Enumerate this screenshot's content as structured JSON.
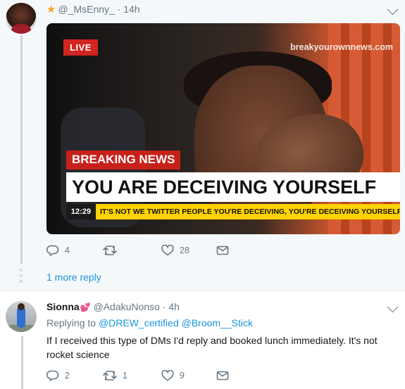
{
  "tweet1": {
    "handle": "@_MsEnny_",
    "time": "14h",
    "media": {
      "live": "LIVE",
      "watermark": "breakyourownnews.com",
      "label": "BREAKING NEWS",
      "headline": "YOU ARE DECEIVING YOURSELF",
      "clock": "12:29",
      "ticker": "IT'S NOT WE TWITTER PEOPLE YOU'RE DECEIVING, YOU'RE DECEIVING YOURSELF BR"
    },
    "actions": {
      "replies": "4",
      "retweets": "",
      "likes": "28"
    }
  },
  "more_replies": "1 more reply",
  "tweet2": {
    "name": "Sionna",
    "handle": "@AdakuNonso",
    "time": "4h",
    "replying_prefix": "Replying to",
    "replying_to": [
      "@DREW_certified",
      "@Broom__Stick"
    ],
    "text": "If I received this type of DMs I'd reply and booked lunch immediately. It's not rocket science",
    "actions": {
      "replies": "2",
      "retweets": "1",
      "likes": "9"
    }
  },
  "colors": {
    "accent": "#1b95e0",
    "muted": "#657786",
    "heart": "#e0245e",
    "breaking_red": "#c8211b",
    "ticker_yellow": "#ffd200"
  },
  "icons": [
    "star-icon",
    "reply-icon",
    "retweet-icon",
    "like-icon",
    "dm-icon",
    "chevron-down-icon",
    "heart-emoji-icon"
  ]
}
